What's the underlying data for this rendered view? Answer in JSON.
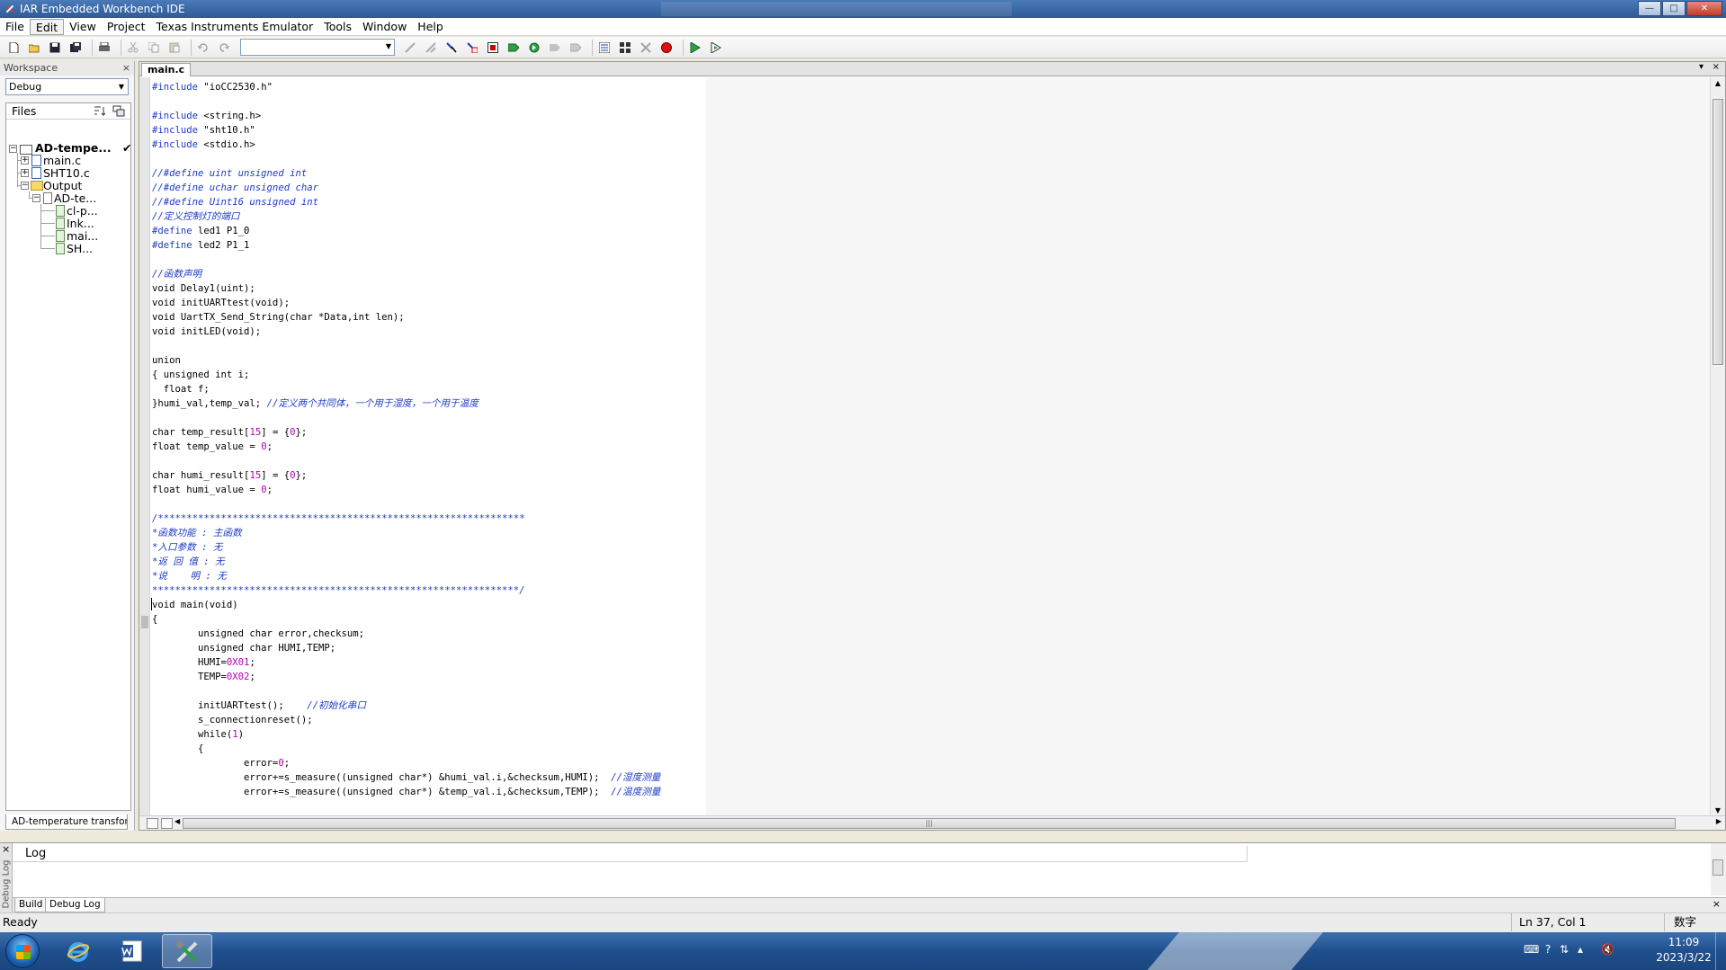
{
  "window": {
    "title": "IAR Embedded Workbench IDE",
    "buttons": {
      "minimize": "—",
      "maximize": "□",
      "close": "✕"
    }
  },
  "menu": [
    "File",
    "Edit",
    "View",
    "Project",
    "Texas Instruments Emulator",
    "Tools",
    "Window",
    "Help"
  ],
  "toolbar": {
    "icons": [
      "new-file-icon",
      "open-icon",
      "save-icon",
      "save-all-icon",
      "print-icon",
      "cut-icon",
      "copy-icon",
      "paste-icon",
      "undo-icon",
      "redo-icon",
      "find-combo",
      "toggle-bookmark-icon",
      "bookmark-next-icon",
      "goto-icon",
      "find-icon",
      "compile-icon",
      "make-icon",
      "stop-build-icon",
      "toggle-breakpoint-icon",
      "debug-icon",
      "download-debug-icon"
    ]
  },
  "workspace": {
    "header": "Workspace",
    "close": "×",
    "configuration": "Debug",
    "files_header": "Files",
    "tree": [
      {
        "label": "AD-tempe...",
        "check": "✔",
        "bold": true
      },
      {
        "label": "main.c"
      },
      {
        "label": "SHT10.c"
      },
      {
        "label": "Output"
      },
      {
        "label": "AD-te..."
      },
      {
        "label": "cl-p..."
      },
      {
        "label": "Ink..."
      },
      {
        "label": "mai..."
      },
      {
        "label": "SH..."
      }
    ],
    "tab": "AD-temperature transform"
  },
  "editor": {
    "tab": "main.c",
    "tab_controls": {
      "dropdown": "▾",
      "close": "×"
    },
    "code": [
      [
        [
          "pp",
          "#include"
        ],
        [
          "kw",
          " \"ioCC2530.h\""
        ]
      ],
      [],
      [
        [
          "pp",
          "#include"
        ],
        [
          "kw",
          " <string.h>"
        ]
      ],
      [
        [
          "pp",
          "#include"
        ],
        [
          "kw",
          " \"sht10.h\""
        ]
      ],
      [
        [
          "pp",
          "#include"
        ],
        [
          "kw",
          " <stdio.h>"
        ]
      ],
      [],
      [
        [
          "cm",
          "//#define uint unsigned int"
        ]
      ],
      [
        [
          "cm",
          "//#define uchar unsigned char"
        ]
      ],
      [
        [
          "cm",
          "//#define Uint16 unsigned int"
        ]
      ],
      [
        [
          "cm",
          "//定义控制灯的端口"
        ]
      ],
      [
        [
          "pp",
          "#define"
        ],
        [
          "kw",
          " led1 P1_0"
        ]
      ],
      [
        [
          "pp",
          "#define"
        ],
        [
          "kw",
          " led2 P1_1"
        ]
      ],
      [],
      [
        [
          "cm",
          "//函数声明"
        ]
      ],
      [
        [
          "kw",
          "void Delay1(uint);"
        ]
      ],
      [
        [
          "kw",
          "void initUARTtest(void);"
        ]
      ],
      [
        [
          "kw",
          "void UartTX_Send_String(char *Data,int len);"
        ]
      ],
      [
        [
          "kw",
          "void initLED(void);"
        ]
      ],
      [],
      [
        [
          "kw",
          "union"
        ]
      ],
      [
        [
          "kw",
          "{ unsigned int i;"
        ]
      ],
      [
        [
          "kw",
          "  float f;"
        ]
      ],
      [
        [
          "kw",
          "}humi_val,temp_val; "
        ],
        [
          "cm",
          "//定义两个共同体，一个用于湿度，一个用于温度"
        ]
      ],
      [],
      [
        [
          "kw",
          "char temp_result["
        ],
        [
          "num",
          "15"
        ],
        [
          "kw",
          "] = {"
        ],
        [
          "num",
          "0"
        ],
        [
          "kw",
          "};"
        ]
      ],
      [
        [
          "kw",
          "float temp_value = "
        ],
        [
          "num",
          "0"
        ],
        [
          "kw",
          ";"
        ]
      ],
      [],
      [
        [
          "kw",
          "char humi_result["
        ],
        [
          "num",
          "15"
        ],
        [
          "kw",
          "] = {"
        ],
        [
          "num",
          "0"
        ],
        [
          "kw",
          "};"
        ]
      ],
      [
        [
          "kw",
          "float humi_value = "
        ],
        [
          "num",
          "0"
        ],
        [
          "kw",
          ";"
        ]
      ],
      [],
      [
        [
          "cm",
          "/****************************************************************"
        ]
      ],
      [
        [
          "cm",
          "*函数功能 : 主函数"
        ]
      ],
      [
        [
          "cm",
          "*入口参数 : 无"
        ]
      ],
      [
        [
          "cm",
          "*返 回 值 : 无"
        ]
      ],
      [
        [
          "cm",
          "*说    明 : 无"
        ]
      ],
      [
        [
          "cm",
          "****************************************************************/"
        ]
      ],
      [
        [
          "kw",
          "void main(void)"
        ]
      ],
      [
        [
          "kw",
          "{"
        ]
      ],
      [
        [
          "kw",
          "        unsigned char error,checksum;"
        ]
      ],
      [
        [
          "kw",
          "        unsigned char HUMI,TEMP;"
        ]
      ],
      [
        [
          "kw",
          "        HUMI="
        ],
        [
          "num",
          "0X01"
        ],
        [
          "kw",
          ";"
        ]
      ],
      [
        [
          "kw",
          "        TEMP="
        ],
        [
          "num",
          "0X02"
        ],
        [
          "kw",
          ";"
        ]
      ],
      [],
      [
        [
          "kw",
          "        initUARTtest();    "
        ],
        [
          "cm",
          "//初始化串口"
        ]
      ],
      [
        [
          "kw",
          "        s_connectionreset();"
        ]
      ],
      [
        [
          "kw",
          "        while("
        ],
        [
          "num",
          "1"
        ],
        [
          "kw",
          ")"
        ]
      ],
      [
        [
          "kw",
          "        {"
        ]
      ],
      [
        [
          "kw",
          "                error="
        ],
        [
          "num",
          "0"
        ],
        [
          "kw",
          ";"
        ]
      ],
      [
        [
          "kw",
          "                error+=s_measure((unsigned char*) &humi_val.i,&checksum,HUMI);  "
        ],
        [
          "cm",
          "//湿度测量"
        ]
      ],
      [
        [
          "kw",
          "                error+=s_measure((unsigned char*) &temp_val.i,&checksum,TEMP);  "
        ],
        [
          "cm",
          "//温度测量"
        ]
      ]
    ]
  },
  "log": {
    "side_title": "Debug Log",
    "close": "×",
    "header": "Log",
    "tabs": [
      "Build",
      "Debug Log"
    ]
  },
  "status": {
    "left": "Ready",
    "position": "Ln 37, Col 1",
    "ime": "数字"
  },
  "taskbar": {
    "clock_time": "11:09",
    "clock_date": "2023/3/22",
    "tray": [
      "keyboard-icon",
      "help-icon",
      "network-icon",
      "show-hidden-icon",
      "volume-muted-icon"
    ]
  },
  "colors": {
    "preprocessor": "#1d3ac8",
    "comment": "#1d3ac8",
    "number": "#b400b4",
    "title_bar": "#2f5a95",
    "taskbar": "#1f4f8d"
  }
}
